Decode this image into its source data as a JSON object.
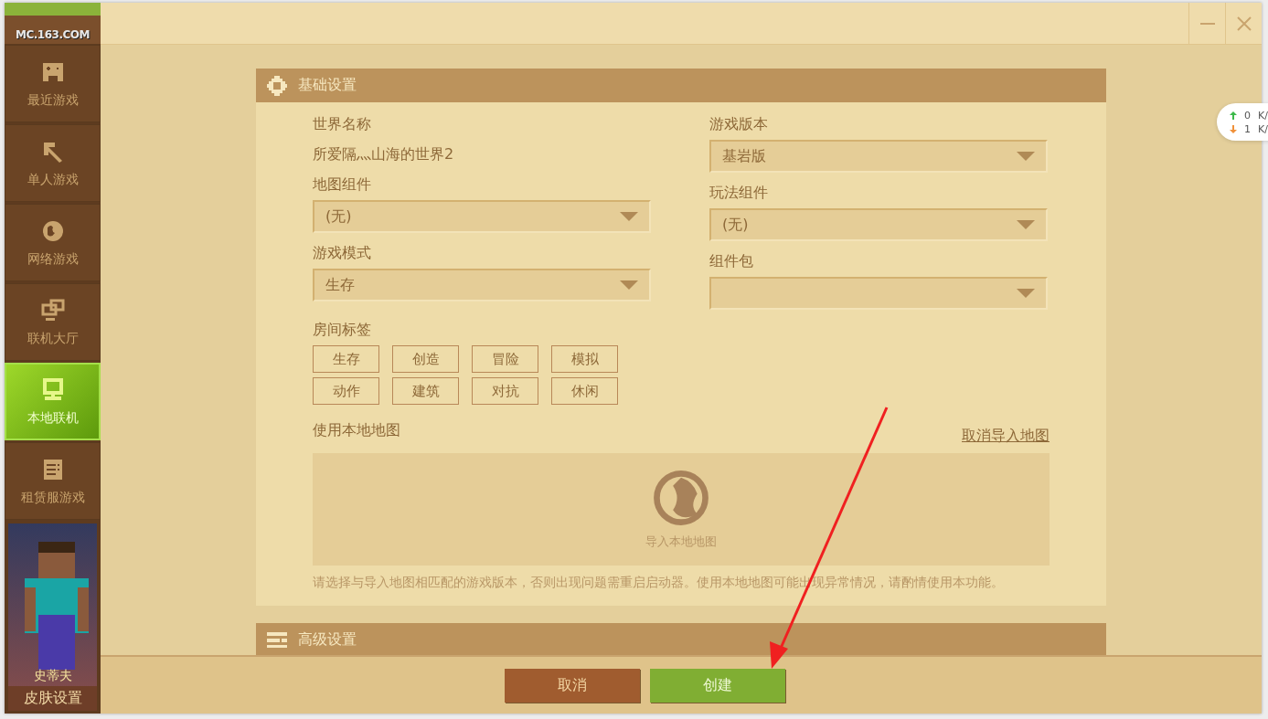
{
  "logo": {
    "text": "MC.163.COM"
  },
  "sidebar": {
    "items": [
      {
        "label": "最近游戏",
        "selected": false
      },
      {
        "label": "单人游戏",
        "selected": false
      },
      {
        "label": "网络游戏",
        "selected": false
      },
      {
        "label": "联机大厅",
        "selected": false
      },
      {
        "label": "本地联机",
        "selected": true
      },
      {
        "label": "租赁服游戏",
        "selected": false
      }
    ],
    "skin": {
      "name": "史蒂夫",
      "button": "皮肤设置"
    }
  },
  "basic_settings": {
    "title": "基础设置",
    "world_name": {
      "label": "世界名称",
      "value": "所爱隔灬山海的世界2"
    },
    "left_fields": [
      {
        "label": "地图组件",
        "value": "(无)"
      },
      {
        "label": "游戏模式",
        "value": "生存"
      }
    ],
    "right_fields": [
      {
        "label": "游戏版本",
        "value": "基岩版"
      },
      {
        "label": "玩法组件",
        "value": "(无)"
      },
      {
        "label": "组件包"
      }
    ],
    "room_tags": {
      "label": "房间标签",
      "tags": [
        "生存",
        "创造",
        "冒险",
        "模拟",
        "动作",
        "建筑",
        "对抗",
        "休闲"
      ]
    },
    "local_map": {
      "label": "使用本地地图",
      "cancel_link": "取消导入地图",
      "import_label": "导入本地地图",
      "note": "请选择与导入地图相匹配的游戏版本，否则出现问题需重启启动器。使用本地地图可能出现异常情况，请酌情使用本功能。"
    }
  },
  "advanced_settings": {
    "title": "高级设置"
  },
  "footer": {
    "buttons": [
      {
        "label": "取消",
        "kind": "cancel"
      },
      {
        "label": "创建",
        "kind": "create"
      }
    ]
  },
  "speed_widget": {
    "up": "0",
    "up_unit": "K/",
    "down": "1",
    "down_unit": "K/"
  }
}
